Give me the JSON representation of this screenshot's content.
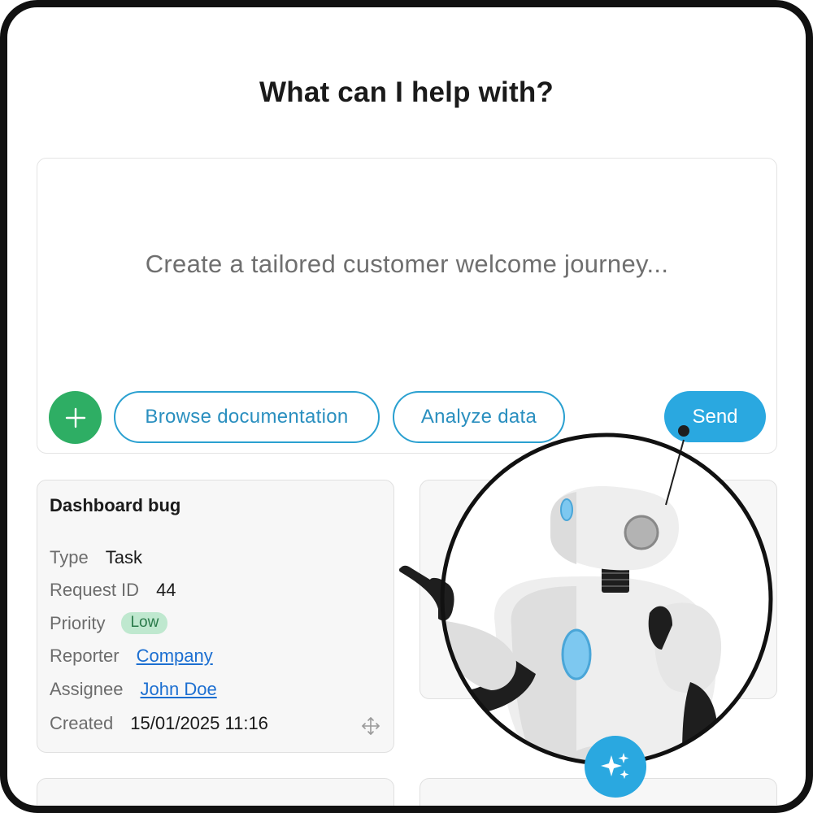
{
  "header": {
    "title": "What can I help with?"
  },
  "prompt": {
    "placeholder": "Create a tailored customer welcome journey...",
    "add_icon": "plus-icon",
    "suggestions": [
      {
        "label": "Browse documentation"
      },
      {
        "label": "Analyze data"
      }
    ],
    "send_label": "Send"
  },
  "task_card": {
    "title": "Dashboard bug",
    "fields": {
      "type": {
        "label": "Type",
        "value": "Task"
      },
      "request_id": {
        "label": "Request ID",
        "value": "44"
      },
      "priority": {
        "label": "Priority",
        "value": "Low"
      },
      "reporter": {
        "label": "Reporter",
        "value": "Company"
      },
      "assignee": {
        "label": "Assignee",
        "value": "John Doe"
      },
      "created": {
        "label": "Created",
        "value": "15/01/2025 11:16"
      }
    },
    "move_icon": "move-icon"
  },
  "assistant": {
    "sparkle_icon": "sparkle-icon",
    "illustration": "robot-pointing"
  },
  "colors": {
    "accent_blue": "#2aa8e0",
    "add_green": "#2eae64",
    "badge_low_bg": "#bfe8cf",
    "link": "#1c6fd1"
  }
}
